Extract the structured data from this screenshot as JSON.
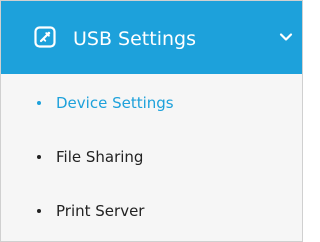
{
  "menu": {
    "header": {
      "title": "USB Settings",
      "icon": "usb-icon",
      "expand_icon": "chevron-down-icon",
      "background": "#1da1db",
      "text_color": "#ffffff"
    },
    "items": [
      {
        "label": "Device Settings",
        "active": true,
        "color": "#1da1db"
      },
      {
        "label": "File Sharing",
        "active": false,
        "color": "#222222"
      },
      {
        "label": "Print Server",
        "active": false,
        "color": "#222222"
      }
    ]
  }
}
